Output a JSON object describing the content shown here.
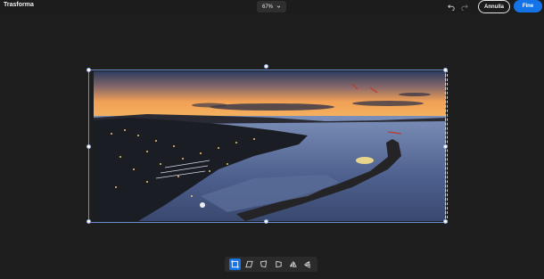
{
  "header": {
    "title": "Trasforma",
    "zoom_label": "67%",
    "undo_icon": "undo-icon",
    "redo_icon": "redo-icon",
    "cancel_label": "Annulla",
    "done_label": "Fine"
  },
  "colors": {
    "accent": "#1473e6",
    "background": "#1e1e1e",
    "toolbar": "#2b2b2b"
  },
  "canvas": {
    "image": "night harbor panorama at sunset"
  },
  "toolbar": {
    "tools": [
      {
        "icon": "transform-free-icon",
        "active": true
      },
      {
        "icon": "skew-icon",
        "active": false
      },
      {
        "icon": "distort-icon",
        "active": false
      },
      {
        "icon": "perspective-icon",
        "active": false
      },
      {
        "icon": "flip-horizontal-icon",
        "active": false
      },
      {
        "icon": "flip-vertical-icon",
        "active": false
      }
    ]
  }
}
